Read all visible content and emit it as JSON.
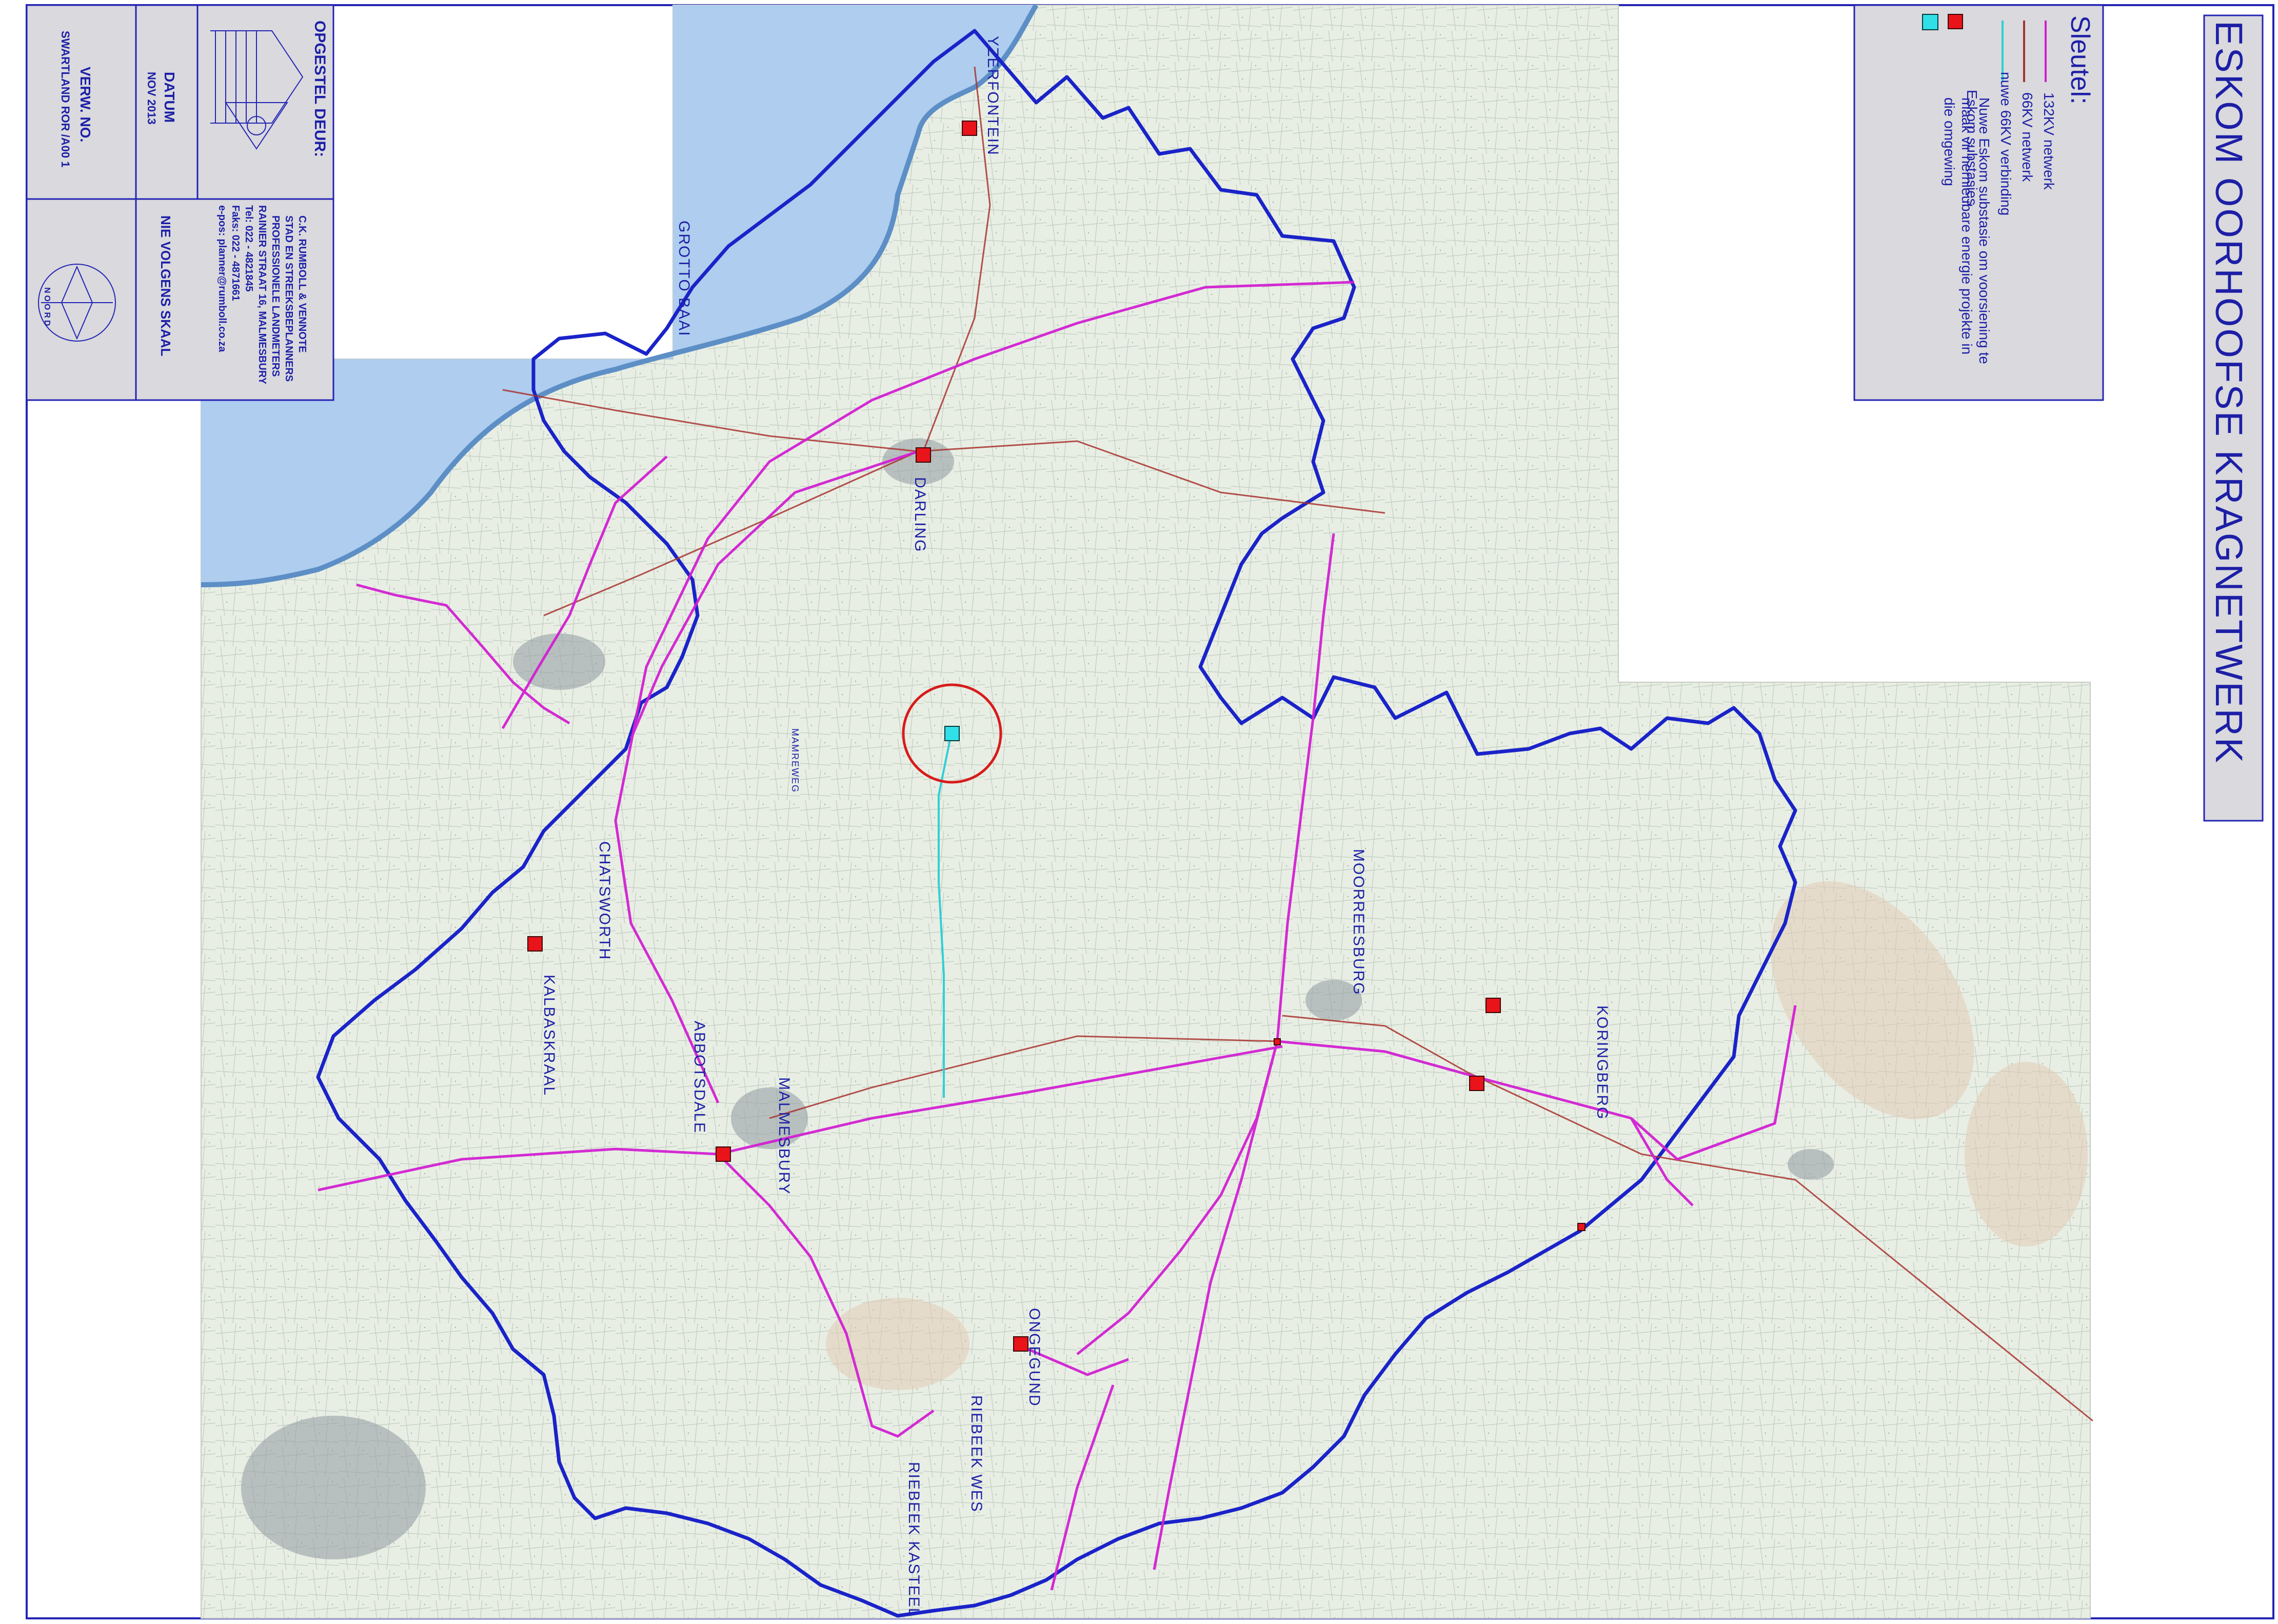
{
  "title": "ESKOM OORHOOFSE KRAGNETWERK",
  "legend": {
    "heading": "Sleutel:",
    "items": [
      {
        "symbol": "line-132kv",
        "label": "132KV netwerk",
        "color": "#d21fd2"
      },
      {
        "symbol": "line-66kv",
        "label": "66KV netwerk",
        "color": "#a8322f"
      },
      {
        "symbol": "line-new-66kv",
        "label": "nuwe 66KV verbinding",
        "color": "#2fd0d6"
      },
      {
        "symbol": "eskom-substation",
        "label": "Eskom substasies",
        "color": "#e8141a"
      },
      {
        "symbol": "new-substation",
        "label": "Nuwe Eskom substasie om voorsiening te maak vir hernieubare energie projekte in die omgewing",
        "color": "#2fe0e8"
      }
    ]
  },
  "title_block": {
    "prepared_by_heading": "OPGESTEL DEUR:",
    "firm_lines": [
      "C.K. RUMBOLL & VENNOTE",
      "STAD EN STREEKSBEPLANNERS",
      "PROFESSIONELE LANDMETERS",
      "RAINIER STRAAT 16, MALMESBURY",
      "Tel: 022 - 4821845",
      "Faks: 022 - 4871661",
      "e-pos: planner@rumboll.co.za"
    ],
    "date_label": "DATUM",
    "date_value": "NOV 2013",
    "scale_label": "NIE VOLGENS SKAAL",
    "ref_label": "VERW. NO.",
    "ref_value": "SWARTLAND ROR /A00 1",
    "north_label": "NOORD"
  },
  "places": [
    {
      "name": "YZERFONTEIN"
    },
    {
      "name": "GROTTO BAAI"
    },
    {
      "name": "DARLING"
    },
    {
      "name": "CHATSWORTH"
    },
    {
      "name": "KALBASKRAAL"
    },
    {
      "name": "ABBOTSDALE"
    },
    {
      "name": "MALMESBURY"
    },
    {
      "name": "MOORREESBURG"
    },
    {
      "name": "KORINGBERG"
    },
    {
      "name": "ONGEGUND"
    },
    {
      "name": "RIEBEEK WES"
    },
    {
      "name": "RIEBEEK KASTEEL"
    },
    {
      "name": "MAMREWEG"
    }
  ],
  "colors": {
    "sea": "#aecdef",
    "land": "#e6ece2",
    "boundary": "#1a23c8",
    "line_132kv": "#d21fd2",
    "line_66kv": "#a8322f",
    "line_new": "#2fd0d6",
    "substation": "#e8141a",
    "new_substation": "#2fe0e8",
    "frame": "#2424b4",
    "label": "#1d1fa6"
  }
}
